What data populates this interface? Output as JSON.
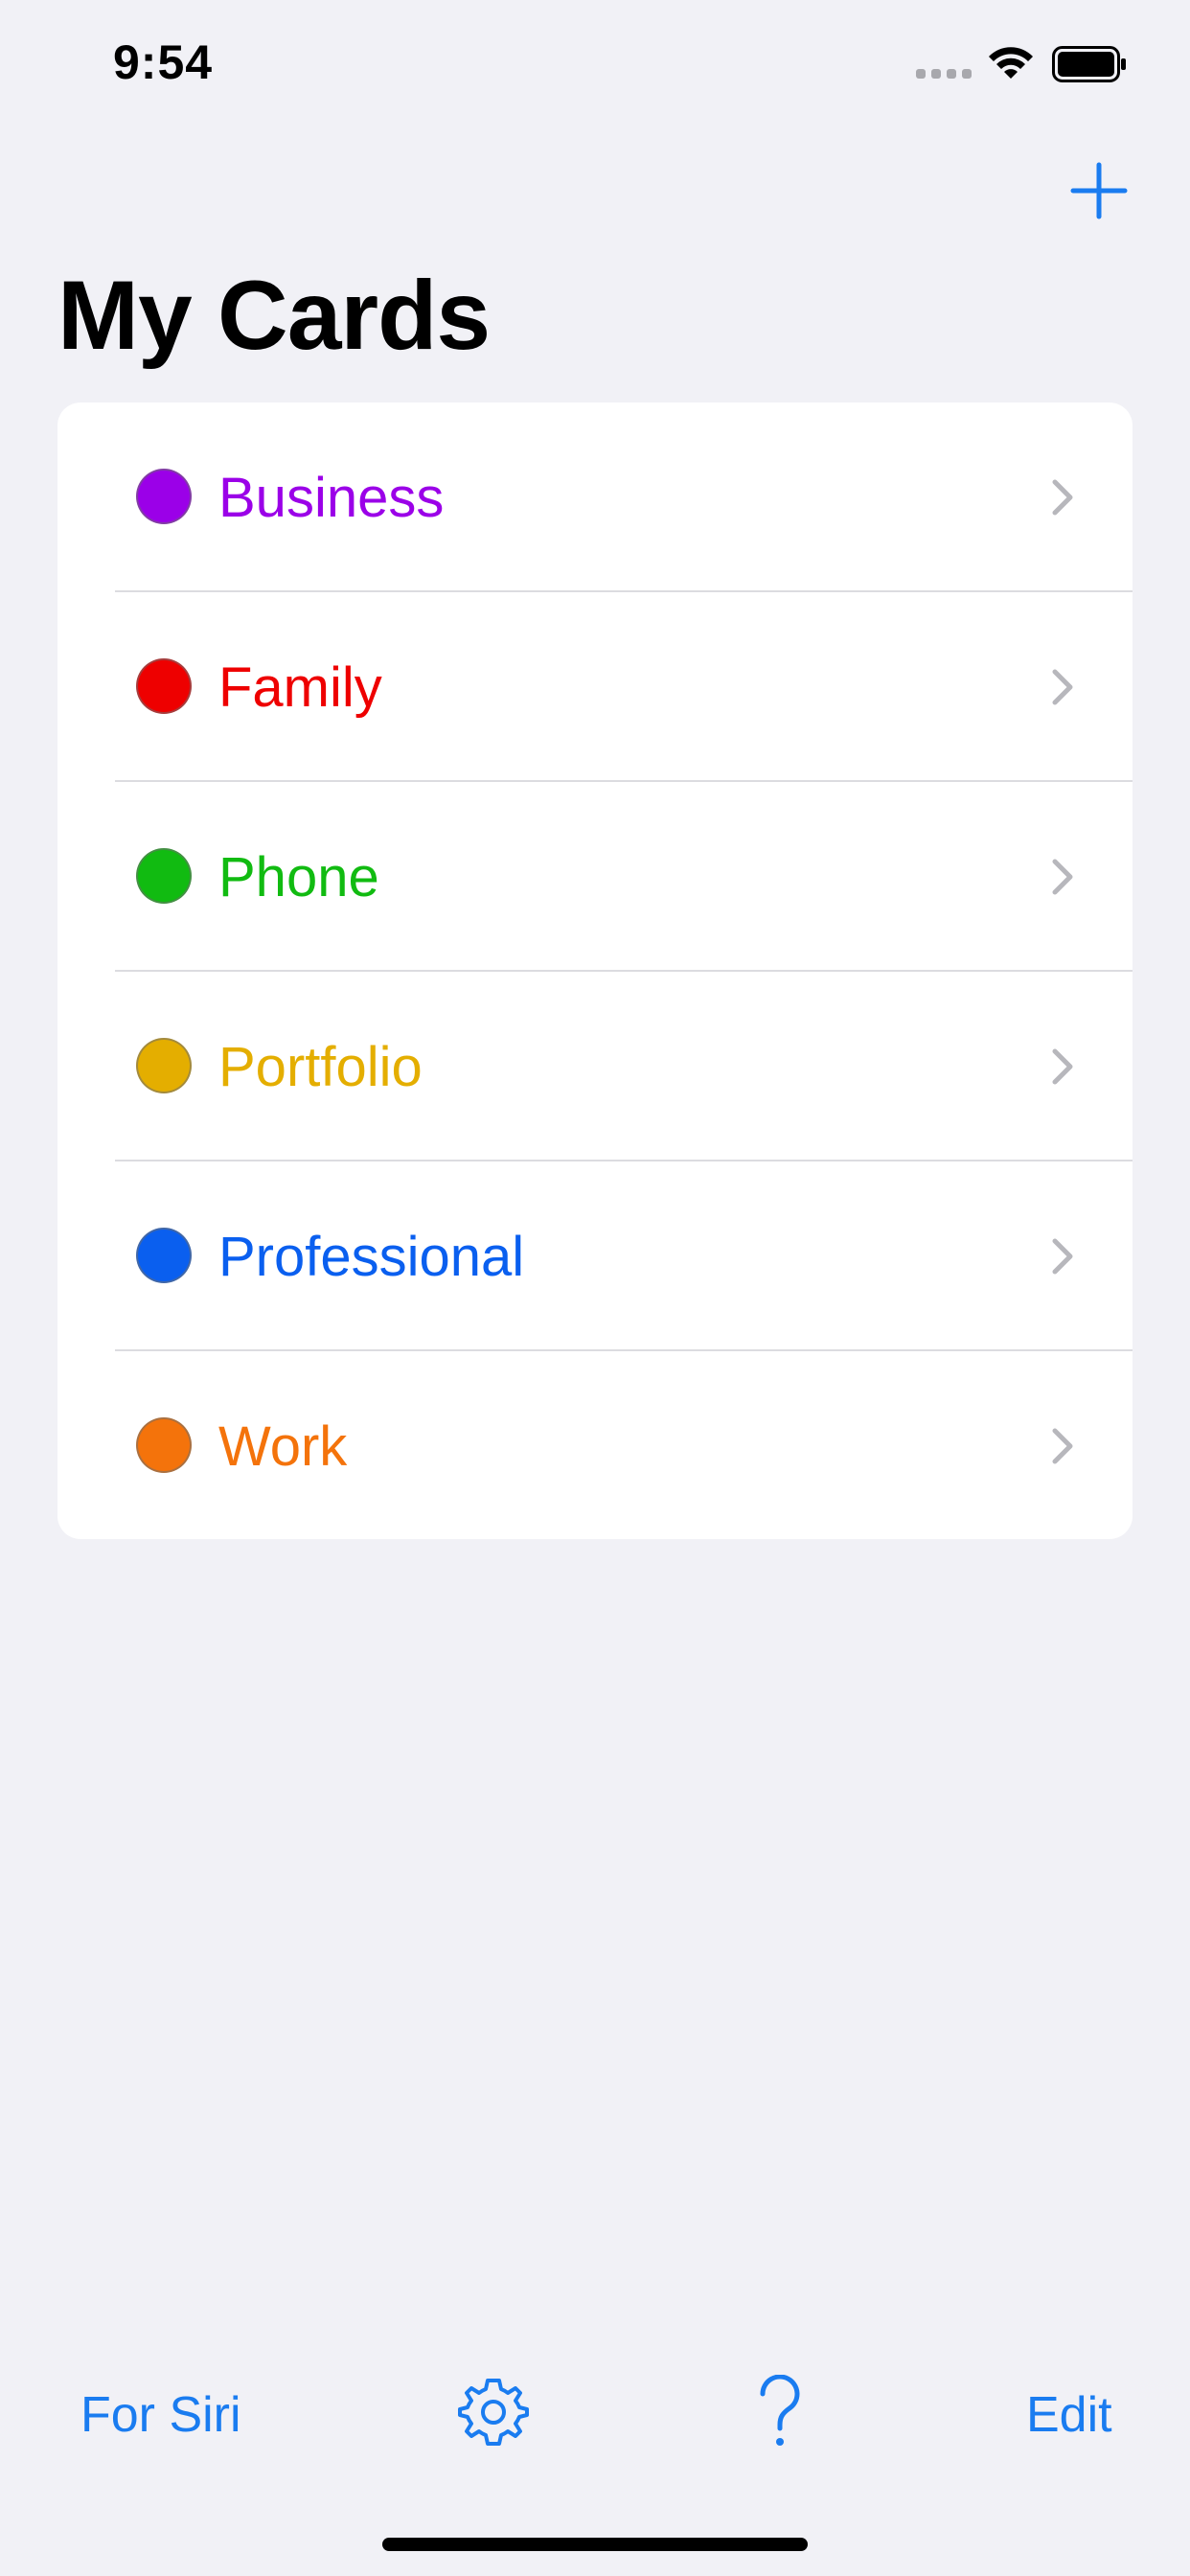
{
  "status_bar": {
    "time": "9:54"
  },
  "header": {
    "title": "My Cards",
    "add_icon": "plus-icon"
  },
  "cards": [
    {
      "label": "Business",
      "color": "#9b00e8"
    },
    {
      "label": "Family",
      "color": "#ee0000"
    },
    {
      "label": "Phone",
      "color": "#11bb11"
    },
    {
      "label": "Portfolio",
      "color": "#e4ae00"
    },
    {
      "label": "Professional",
      "color": "#0a5fef"
    },
    {
      "label": "Work",
      "color": "#f4730b"
    }
  ],
  "toolbar": {
    "for_siri_label": "For Siri",
    "settings_icon": "gear-icon",
    "help_icon": "question-mark-icon",
    "edit_label": "Edit"
  },
  "colors": {
    "accent": "#1a7cf0",
    "background": "#f1f1f6"
  }
}
